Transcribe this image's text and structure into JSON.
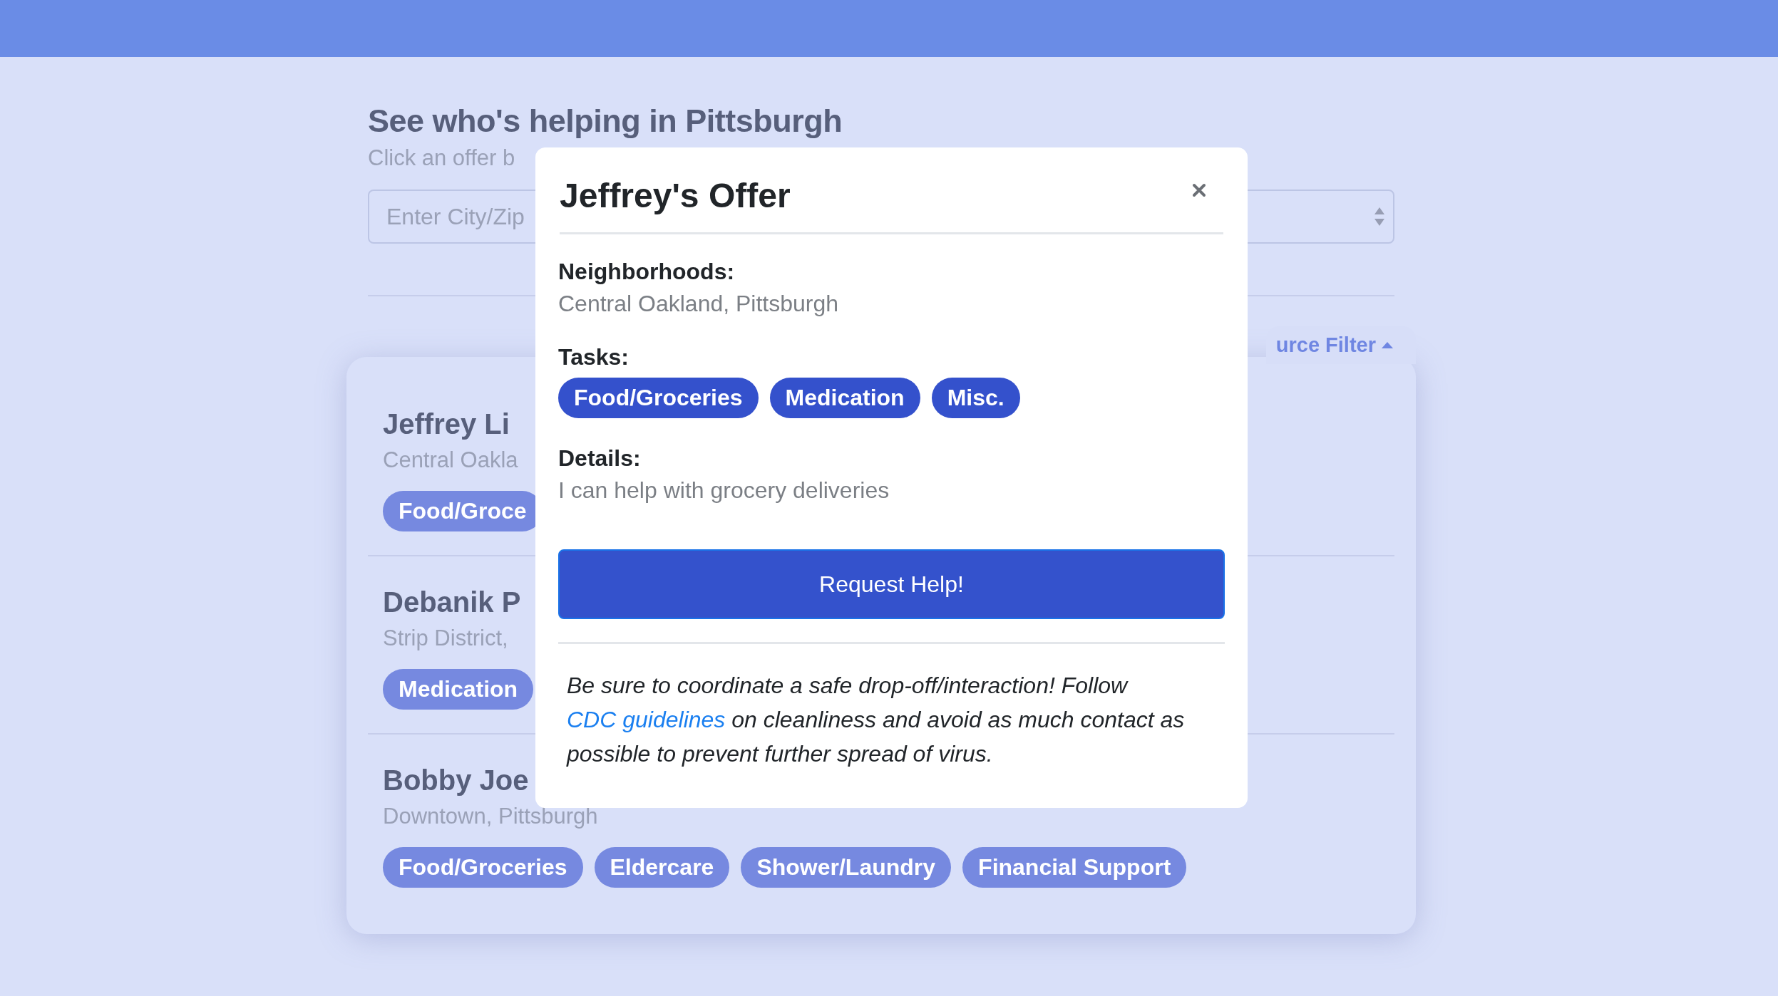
{
  "page": {
    "title": "See who's helping in Pittsburgh",
    "subtitle": "Click an offer b"
  },
  "search": {
    "placeholder": "Enter City/Zip"
  },
  "filter": {
    "label": "urce Filter",
    "expanded": true
  },
  "offers": [
    {
      "name": "Jeffrey Li",
      "location": "Central Oakla",
      "tasks": [
        "Food/Groce"
      ]
    },
    {
      "name": "Debanik P",
      "location": "Strip District,",
      "tasks": [
        "Medication"
      ]
    },
    {
      "name": "Bobby Joe",
      "location": "Downtown, Pittsburgh",
      "tasks": [
        "Food/Groceries",
        "Eldercare",
        "Shower/Laundry",
        "Financial Support"
      ]
    }
  ],
  "modal": {
    "title": "Jeffrey's Offer",
    "neighborhoods": {
      "label": "Neighborhoods:",
      "value": "Central Oakland, Pittsburgh"
    },
    "tasks": {
      "label": "Tasks:",
      "items": [
        "Food/Groceries",
        "Medication",
        "Misc."
      ]
    },
    "details": {
      "label": "Details:",
      "value": "I can help with grocery deliveries"
    },
    "button": "Request Help!",
    "note": {
      "before": "Be sure to coordinate a safe drop-off/interaction! Follow ",
      "link": "CDC guidelines",
      "after": " on cleanliness and avoid as much contact as possible to prevent further spread of virus."
    }
  }
}
